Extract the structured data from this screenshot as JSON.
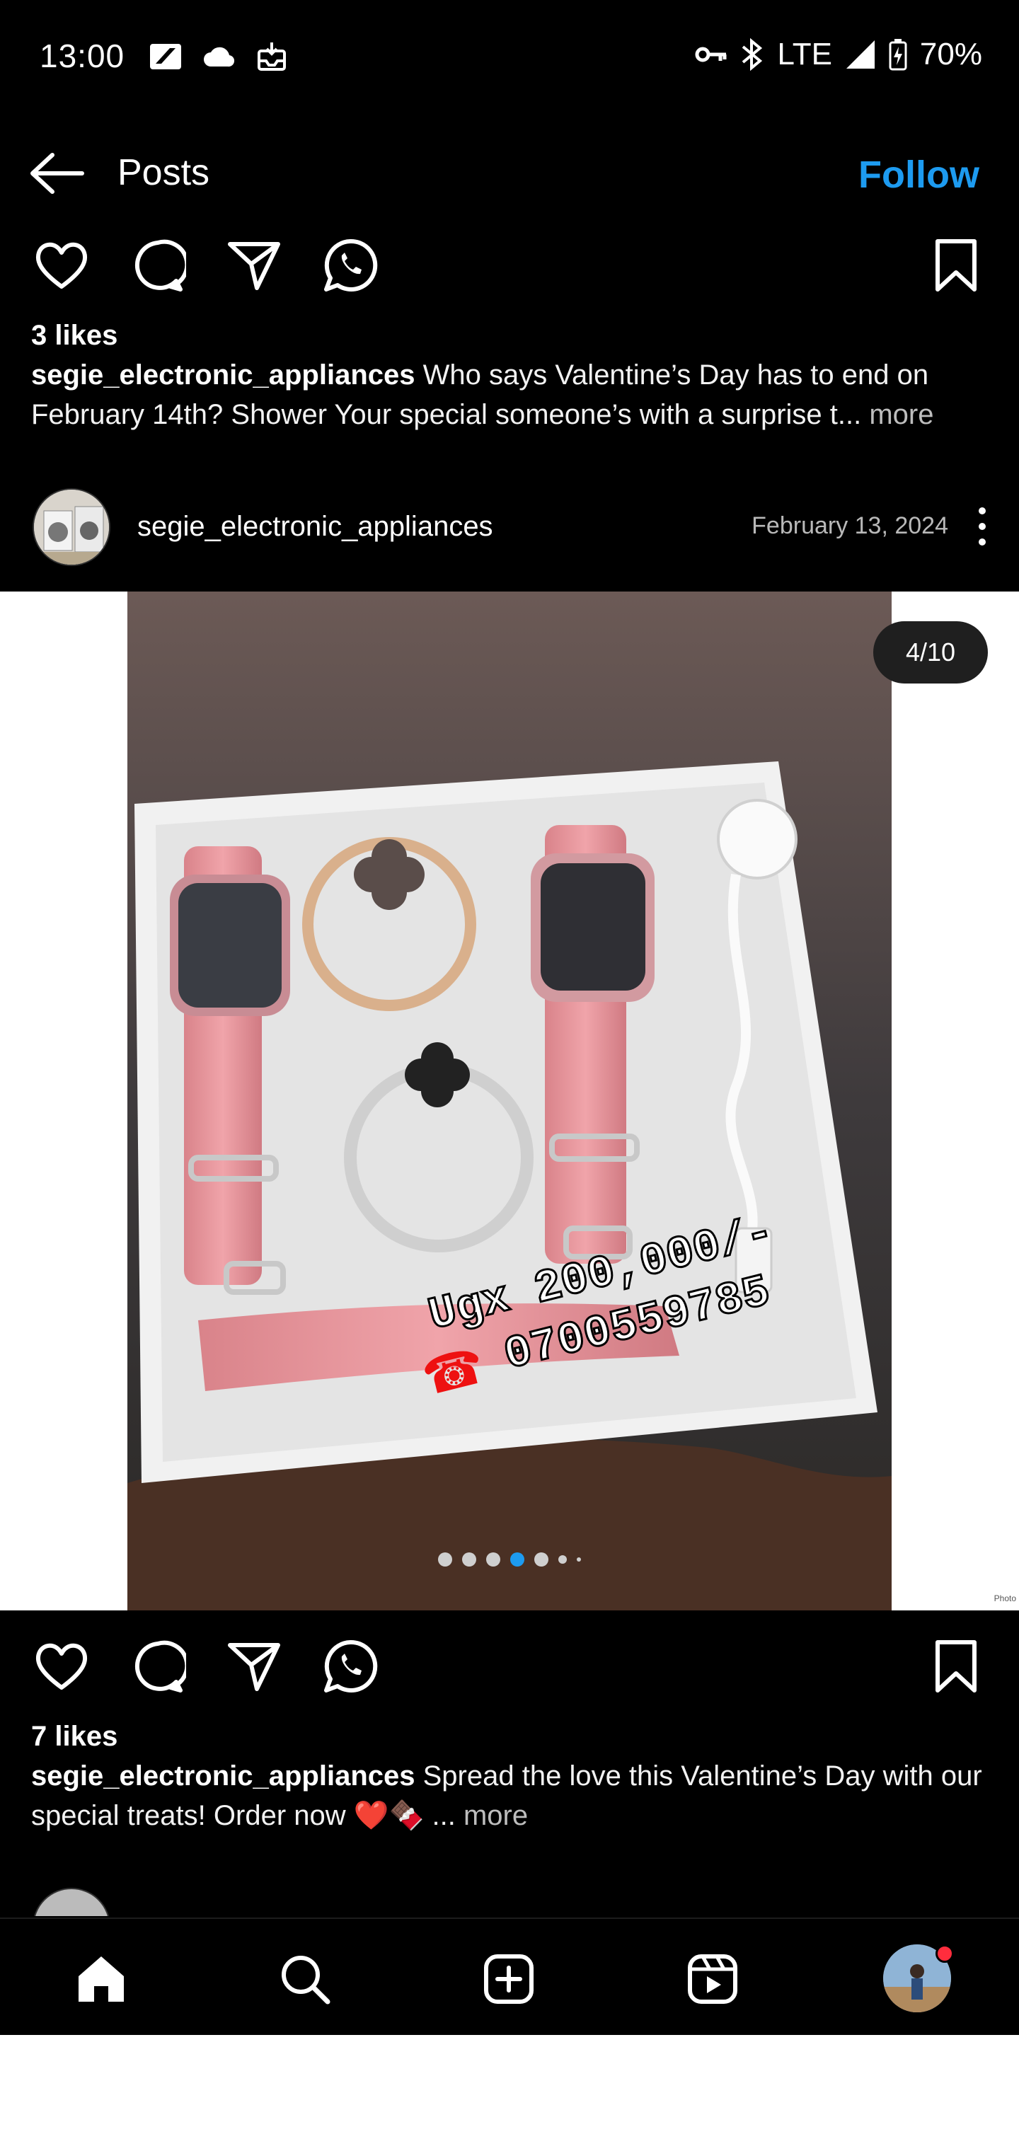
{
  "status_bar": {
    "time": "13:00",
    "network": "LTE",
    "battery": "70%",
    "icons_left": [
      "news-icon",
      "cloud-icon",
      "inbox-icon"
    ],
    "icons_right": [
      "key-icon",
      "bluetooth-icon",
      "signal-icon",
      "battery-icon"
    ]
  },
  "header": {
    "title": "Posts",
    "follow_label": "Follow"
  },
  "post1": {
    "likes": "3 likes",
    "username": "segie_electronic_appliances",
    "caption": "Who says Valentine’s Day has to end on February 14th? Shower Your  special someone’s with a surprise t...",
    "more": "more"
  },
  "post2": {
    "username": "segie_electronic_appliances",
    "date": "February 13, 2024",
    "counter": "4/10",
    "image_price_text": "Ugx 200,000/-",
    "image_phone_text": "0700559785",
    "photo_tag": "Photo",
    "carousel": {
      "total_dots_visible": 6,
      "active_index": 3
    },
    "likes": "7 likes",
    "caption": "Spread the love this Valentine’s Day with our special treats! Order now ❤️🍫 ...",
    "more": "more"
  },
  "colors": {
    "accent": "#1d9bf0",
    "background": "#000000",
    "notification": "#ff2d3d"
  },
  "bottom_nav": [
    "home-icon",
    "search-icon",
    "create-icon",
    "reels-icon",
    "profile-avatar"
  ]
}
